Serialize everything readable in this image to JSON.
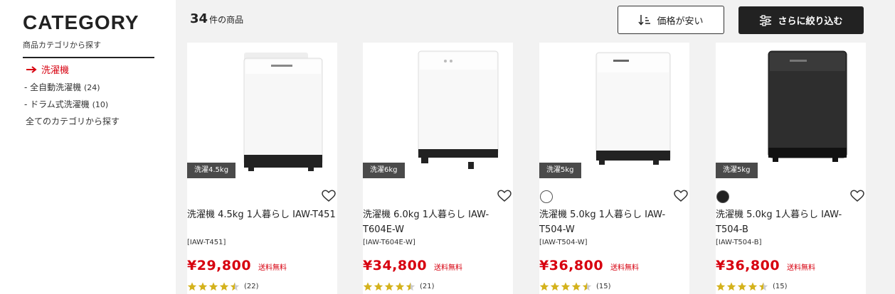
{
  "sidebar": {
    "title": "CATEGORY",
    "subtitle": "商品カテゴリから探す",
    "current": "洗濯機",
    "subcategories": [
      {
        "label": "- 全自動洗濯機",
        "count": "(24)"
      },
      {
        "label": "- ドラム式洗濯機",
        "count": "(10)"
      }
    ],
    "all_link": "全てのカテゴリから探す"
  },
  "header": {
    "count_number": "34",
    "count_unit": "件の商品",
    "sort_label": "価格が安い",
    "filter_label": "さらに絞り込む"
  },
  "products": [
    {
      "capacity": "洗濯4.5kg",
      "name": "洗濯機 4.5kg 1人暮らし IAW-T451",
      "model": "[IAW-T451]",
      "price": "¥29,800",
      "shipping": "送料無料",
      "rating": 4.5,
      "reviews": "(22)",
      "color_swatch": null
    },
    {
      "capacity": "洗濯6kg",
      "name": "洗濯機 6.0kg 1人暮らし IAW-T604E-W",
      "model": "[IAW-T604E-W]",
      "price": "¥34,800",
      "shipping": "送料無料",
      "rating": 4.5,
      "reviews": "(21)",
      "color_swatch": null
    },
    {
      "capacity": "洗濯5kg",
      "name": "洗濯機 5.0kg 1人暮らし IAW-T504-W",
      "model": "[IAW-T504-W]",
      "price": "¥36,800",
      "shipping": "送料無料",
      "rating": 4.5,
      "reviews": "(15)",
      "color_swatch": "#ffffff"
    },
    {
      "capacity": "洗濯5kg",
      "name": "洗濯機 5.0kg 1人暮らし IAW-T504-B",
      "model": "[IAW-T504-B]",
      "price": "¥36,800",
      "shipping": "送料無料",
      "rating": 4.5,
      "reviews": "(15)",
      "color_swatch": "#222222"
    }
  ],
  "colors": {
    "accent": "#d7000f",
    "dark_button": "#222222",
    "star": "#d4b21c",
    "background": "#f2f2f2"
  }
}
